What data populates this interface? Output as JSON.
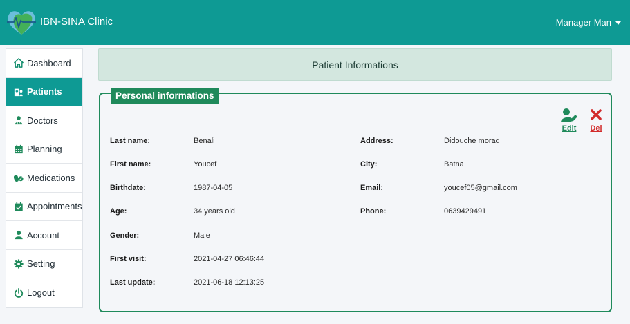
{
  "app": {
    "name": "IBN-SINA Clinic"
  },
  "user_menu": {
    "label": "Manager Man"
  },
  "sidebar": {
    "items": [
      {
        "label": "Dashboard",
        "icon": "home-icon",
        "active": false
      },
      {
        "label": "Patients",
        "icon": "hospital-user-icon",
        "active": true
      },
      {
        "label": "Doctors",
        "icon": "doctor-icon",
        "active": false
      },
      {
        "label": "Planning",
        "icon": "calendar-icon",
        "active": false
      },
      {
        "label": "Medications",
        "icon": "pills-icon",
        "active": false
      },
      {
        "label": "Appointments",
        "icon": "calendar-check-icon",
        "active": false
      },
      {
        "label": "Account",
        "icon": "user-icon",
        "active": false
      },
      {
        "label": "Setting",
        "icon": "gear-icon",
        "active": false
      },
      {
        "label": "Logout",
        "icon": "power-icon",
        "active": false
      }
    ]
  },
  "page": {
    "title": "Patient Informations"
  },
  "card": {
    "title": "Personal informations",
    "edit_label": "Edit",
    "delete_label": "Del"
  },
  "patient": {
    "left": [
      {
        "label": "Last name:",
        "value": "Benali"
      },
      {
        "label": "First name:",
        "value": "Youcef"
      },
      {
        "label": "Birthdate:",
        "value": "1987-04-05"
      },
      {
        "label": "Age:",
        "value": "34 years old"
      },
      {
        "label": "Gender:",
        "value": "Male"
      },
      {
        "label": "First visit:",
        "value": "2021-04-27 06:46:44"
      },
      {
        "label": "Last update:",
        "value": "2021-06-18 12:13:25"
      }
    ],
    "right": [
      {
        "label": "Address:",
        "value": "Didouche morad"
      },
      {
        "label": "City:",
        "value": "Batna"
      },
      {
        "label": "Email:",
        "value": "youcef05@gmail.com"
      },
      {
        "label": "Phone:",
        "value": "0639429491"
      }
    ]
  },
  "colors": {
    "topbar": "#0e9a94",
    "active_nav": "#0e9a94",
    "card_border": "#1f8a5b",
    "header_bg": "#d3e7df",
    "delete": "#d22b2b"
  }
}
